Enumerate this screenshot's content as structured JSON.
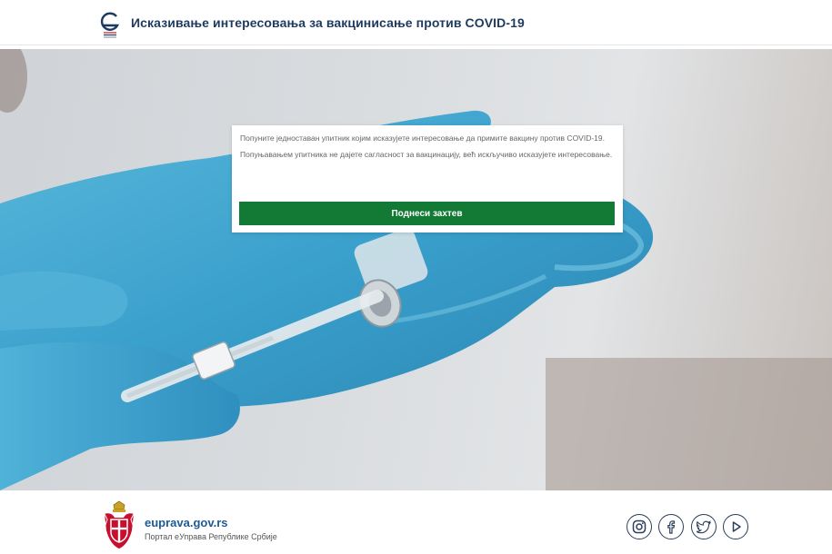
{
  "header": {
    "logo_icon": "eid-logo-icon",
    "title": "Исказивање интересовања за вакцинисање против COVID-19"
  },
  "card": {
    "paragraph_1": "Попуните једноставан упитник којим исказујете интересовање да примите вакцину против COVID-19.",
    "paragraph_2": "Попуњавањем упитника не дајете сагласност за вакцинацију, већ искључиво исказујете интересовање.",
    "submit_label": "Поднеси захтев",
    "accent": "#127a34"
  },
  "footer": {
    "site": "euprava.gov.rs",
    "subtitle": "Портал еУправа Републике Србије",
    "emblem_icon": "serbian-coat-of-arms-icon",
    "social": [
      {
        "icon": "instagram-icon"
      },
      {
        "icon": "facebook-icon"
      },
      {
        "icon": "twitter-icon"
      },
      {
        "icon": "youtube-icon"
      }
    ]
  }
}
